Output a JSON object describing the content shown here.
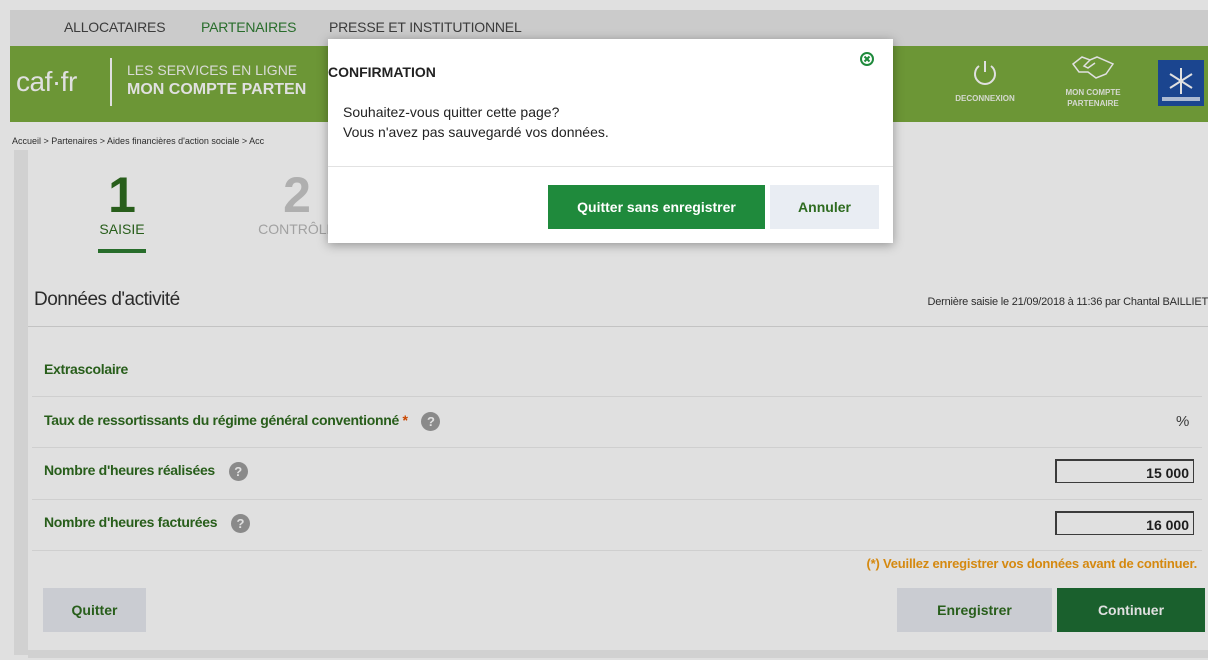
{
  "top_nav": {
    "items": [
      {
        "label": "ALLOCATAIRES",
        "active": false
      },
      {
        "label": "PARTENAIRES",
        "active": true
      },
      {
        "label": "PRESSE ET INSTITUTIONNEL",
        "active": false
      }
    ]
  },
  "header": {
    "logo": "caf·fr",
    "line1": "LES SERVICES EN LIGNE",
    "line2": "MON COMPTE PARTEN",
    "logout_label": "DECONNEXION",
    "account_label_1": "MON COMPTE",
    "account_label_2": "PARTENAIRE",
    "brand_color": "#7cab3e"
  },
  "breadcrumb": "Accueil > Partenaires > Aides financières d'action sociale > Acc",
  "steps": [
    {
      "number": "1",
      "label": "SAISIE",
      "active": true
    },
    {
      "number": "2",
      "label": "CONTRÔLE",
      "active": false
    }
  ],
  "section": {
    "title": "Données d'activité",
    "last_saved": "Dernière saisie le 21/09/2018 à 11:36 par Chantal BAILLIET"
  },
  "form": {
    "category": "Extrascolaire",
    "rate_label": "Taux de ressortissants du régime général conventionné",
    "required_mark": "*",
    "rate_unit": "%",
    "hours_done_label": "Nombre d'heures réalisées",
    "hours_done_value": "15 000",
    "hours_billed_label": "Nombre d'heures facturées",
    "hours_billed_value": "16 000",
    "help_glyph": "?"
  },
  "warning": "(*) Veuillez enregistrer vos données avant de continuer.",
  "actions": {
    "quit": "Quitter",
    "save": "Enregistrer",
    "continue": "Continuer"
  },
  "modal": {
    "title": "CONFIRMATION",
    "line1": "Souhaitez-vous quitter cette page?",
    "line2": "Vous n'avez pas sauvegardé vos données.",
    "confirm": "Quitter sans enregistrer",
    "cancel": "Annuler",
    "close_icon": "close-circle-icon"
  },
  "colors": {
    "primary_green": "#1e6e34",
    "label_green": "#2e6b1f",
    "warning_orange": "#f39c12",
    "required_orange": "#e65100"
  }
}
